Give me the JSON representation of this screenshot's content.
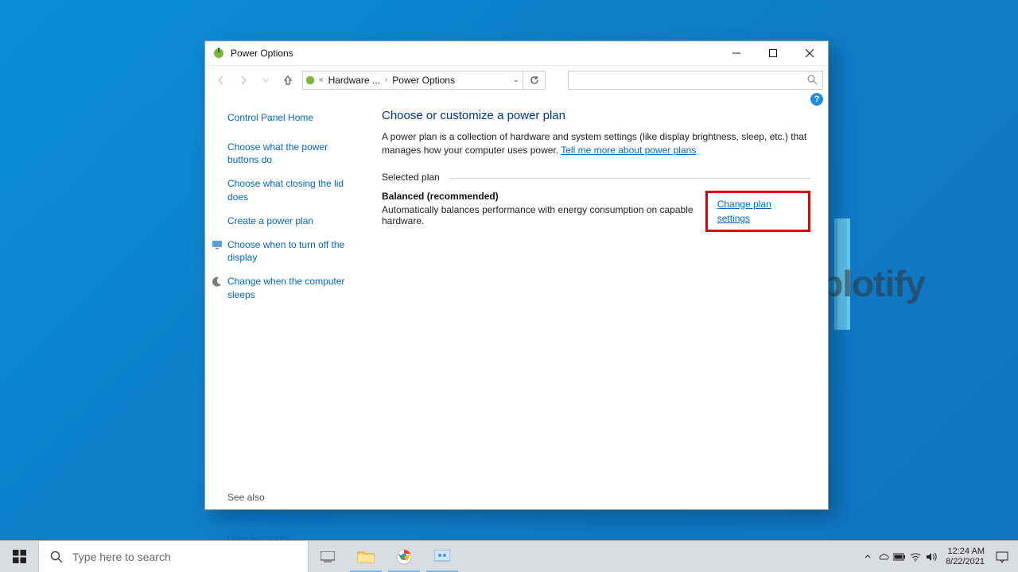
{
  "window": {
    "title": "Power Options",
    "breadcrumb": {
      "seg1": "Hardware ...",
      "seg2": "Power Options"
    }
  },
  "sidebar": {
    "home": "Control Panel Home",
    "items": [
      "Choose what the power buttons do",
      "Choose what closing the lid does",
      "Create a power plan",
      "Choose when to turn off the display",
      "Change when the computer sleeps"
    ],
    "see_also_label": "See also",
    "see_also": [
      "Windows Mobility Center",
      "User Accounts"
    ]
  },
  "content": {
    "heading": "Choose or customize a power plan",
    "desc_pre": "A power plan is a collection of hardware and system settings (like display brightness, sleep, etc.) that manages how your computer uses power. ",
    "desc_link": "Tell me more about power plans",
    "selected_label": "Selected plan",
    "plan_name": "Balanced (recommended)",
    "plan_sub": "Automatically balances performance with energy consumption on capable hardware.",
    "change_link": "Change plan settings"
  },
  "taskbar": {
    "search_placeholder": "Type here to search",
    "clock_time": "12:24 AM",
    "clock_date": "8/22/2021"
  },
  "watermark": "uplotify"
}
